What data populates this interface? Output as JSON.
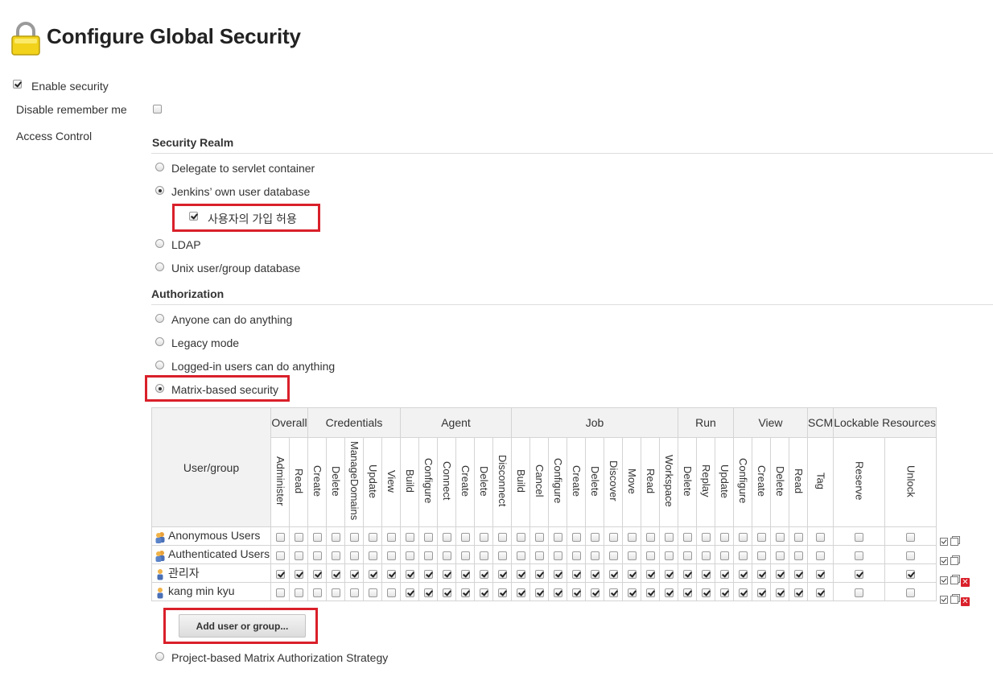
{
  "page": {
    "title": "Configure Global Security"
  },
  "enable_security": {
    "label": "Enable security",
    "checked": true
  },
  "disable_remember_me": {
    "label": "Disable remember me",
    "checked": false
  },
  "access_control": {
    "label": "Access Control"
  },
  "security_realm": {
    "heading": "Security Realm",
    "options": [
      {
        "label": "Delegate to servlet container",
        "selected": false
      },
      {
        "label": "Jenkins’ own user database",
        "selected": true
      },
      {
        "label": "LDAP",
        "selected": false
      },
      {
        "label": "Unix user/group database",
        "selected": false
      }
    ],
    "allow_signup": {
      "label": "사용자의 가입 허용",
      "checked": true
    }
  },
  "authorization": {
    "heading": "Authorization",
    "options": [
      {
        "label": "Anyone can do anything",
        "selected": false
      },
      {
        "label": "Legacy mode",
        "selected": false
      },
      {
        "label": "Logged-in users can do anything",
        "selected": false
      },
      {
        "label": "Matrix-based security",
        "selected": true
      }
    ],
    "project_matrix": {
      "label": "Project-based Matrix Authorization Strategy",
      "selected": false
    }
  },
  "matrix": {
    "user_group_header": "User/group",
    "groups": [
      {
        "name": "Overall",
        "perms": [
          "Administer",
          "Read"
        ]
      },
      {
        "name": "Credentials",
        "perms": [
          "Create",
          "Delete",
          "ManageDomains",
          "Update",
          "View"
        ]
      },
      {
        "name": "Agent",
        "perms": [
          "Build",
          "Configure",
          "Connect",
          "Create",
          "Delete",
          "Disconnect"
        ]
      },
      {
        "name": "Job",
        "perms": [
          "Build",
          "Cancel",
          "Configure",
          "Create",
          "Delete",
          "Discover",
          "Move",
          "Read",
          "Workspace"
        ]
      },
      {
        "name": "Run",
        "perms": [
          "Delete",
          "Replay",
          "Update"
        ]
      },
      {
        "name": "View",
        "perms": [
          "Configure",
          "Create",
          "Delete",
          "Read"
        ]
      },
      {
        "name": "SCM",
        "perms": [
          "Tag"
        ]
      },
      {
        "name": "Lockable Resources",
        "perms": [
          "Reserve",
          "Unlock"
        ]
      }
    ],
    "rows": [
      {
        "name": "Anonymous Users",
        "icon": "group-icon",
        "deletable": false,
        "checks": [
          0,
          0,
          0,
          0,
          0,
          0,
          0,
          0,
          0,
          0,
          0,
          0,
          0,
          0,
          0,
          0,
          0,
          0,
          0,
          0,
          0,
          0,
          0,
          0,
          0,
          0,
          0,
          0,
          0,
          0,
          0,
          0
        ]
      },
      {
        "name": "Authenticated Users",
        "icon": "group-icon",
        "deletable": false,
        "checks": [
          0,
          0,
          0,
          0,
          0,
          0,
          0,
          0,
          0,
          0,
          0,
          0,
          0,
          0,
          0,
          0,
          0,
          0,
          0,
          0,
          0,
          0,
          0,
          0,
          0,
          0,
          0,
          0,
          0,
          0,
          0,
          0
        ]
      },
      {
        "name": "관리자",
        "icon": "user-icon",
        "deletable": true,
        "checks": [
          1,
          1,
          1,
          1,
          1,
          1,
          1,
          1,
          1,
          1,
          1,
          1,
          1,
          1,
          1,
          1,
          1,
          1,
          1,
          1,
          1,
          1,
          1,
          1,
          1,
          1,
          1,
          1,
          1,
          1,
          1,
          1
        ]
      },
      {
        "name": "kang min kyu",
        "icon": "user-icon",
        "deletable": true,
        "checks": [
          0,
          0,
          0,
          0,
          0,
          0,
          0,
          1,
          1,
          1,
          1,
          1,
          1,
          1,
          1,
          1,
          1,
          1,
          1,
          1,
          1,
          1,
          1,
          1,
          1,
          1,
          1,
          1,
          1,
          1,
          0,
          0
        ]
      }
    ]
  },
  "add_button": {
    "label": "Add user or group..."
  },
  "colors": {
    "accent_red": "#d9202a",
    "lock_yellow": "#f2d21b"
  }
}
